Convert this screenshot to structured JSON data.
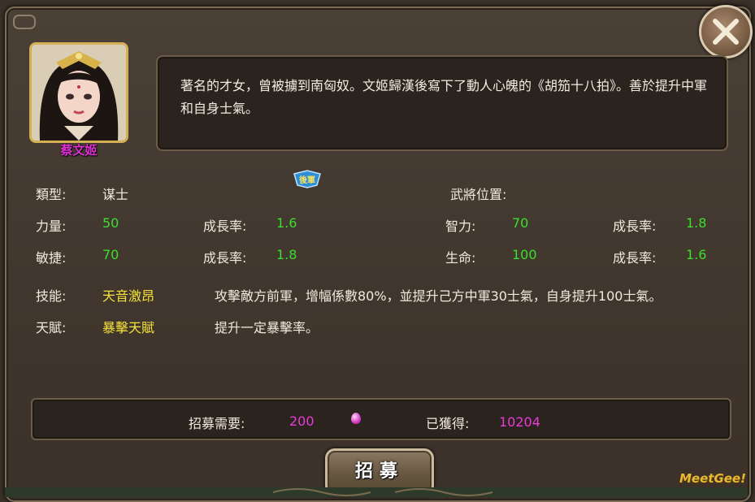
{
  "hero": {
    "name": "蔡文姬",
    "description": "著名的才女，曾被擄到南匈奴。文姬歸漢後寫下了動人心魄的《胡笳十八拍》。善於提升中軍和自身士氣。"
  },
  "badge": {
    "text": "後軍"
  },
  "stats": {
    "type_label": "類型:",
    "type_value": "谋士",
    "position_label": "武將位置:",
    "strength_label": "力量:",
    "strength_value": "50",
    "strength_growth_label": "成長率:",
    "strength_growth_value": "1.6",
    "intelligence_label": "智力:",
    "intelligence_value": "70",
    "intelligence_growth_label": "成長率:",
    "intelligence_growth_value": "1.8",
    "agility_label": "敏捷:",
    "agility_value": "70",
    "agility_growth_label": "成長率:",
    "agility_growth_value": "1.8",
    "life_label": "生命:",
    "life_value": "100",
    "life_growth_label": "成長率:",
    "life_growth_value": "1.6",
    "skill_label": "技能:",
    "skill_name": "天音激昂",
    "skill_desc": "攻擊敵方前軍，增幅係數80%，並提升己方中軍30士氣，自身提升100士氣。",
    "talent_label": "天賦:",
    "talent_name": "暴擊天賦",
    "talent_desc": "提升一定暴擊率。"
  },
  "recruit": {
    "need_label": "招募需要:",
    "need_value": "200",
    "owned_label": "已獲得:",
    "owned_value": "10204",
    "button_label": "招募",
    "currency_icon": "pink-gem-icon"
  },
  "watermark": "MeetGee!",
  "colors": {
    "panel": "#40362d",
    "green_value": "#3bdf2e",
    "pink_value": "#e83bd9",
    "yellow_value": "#f5e23a",
    "name": "#e02fd4"
  }
}
